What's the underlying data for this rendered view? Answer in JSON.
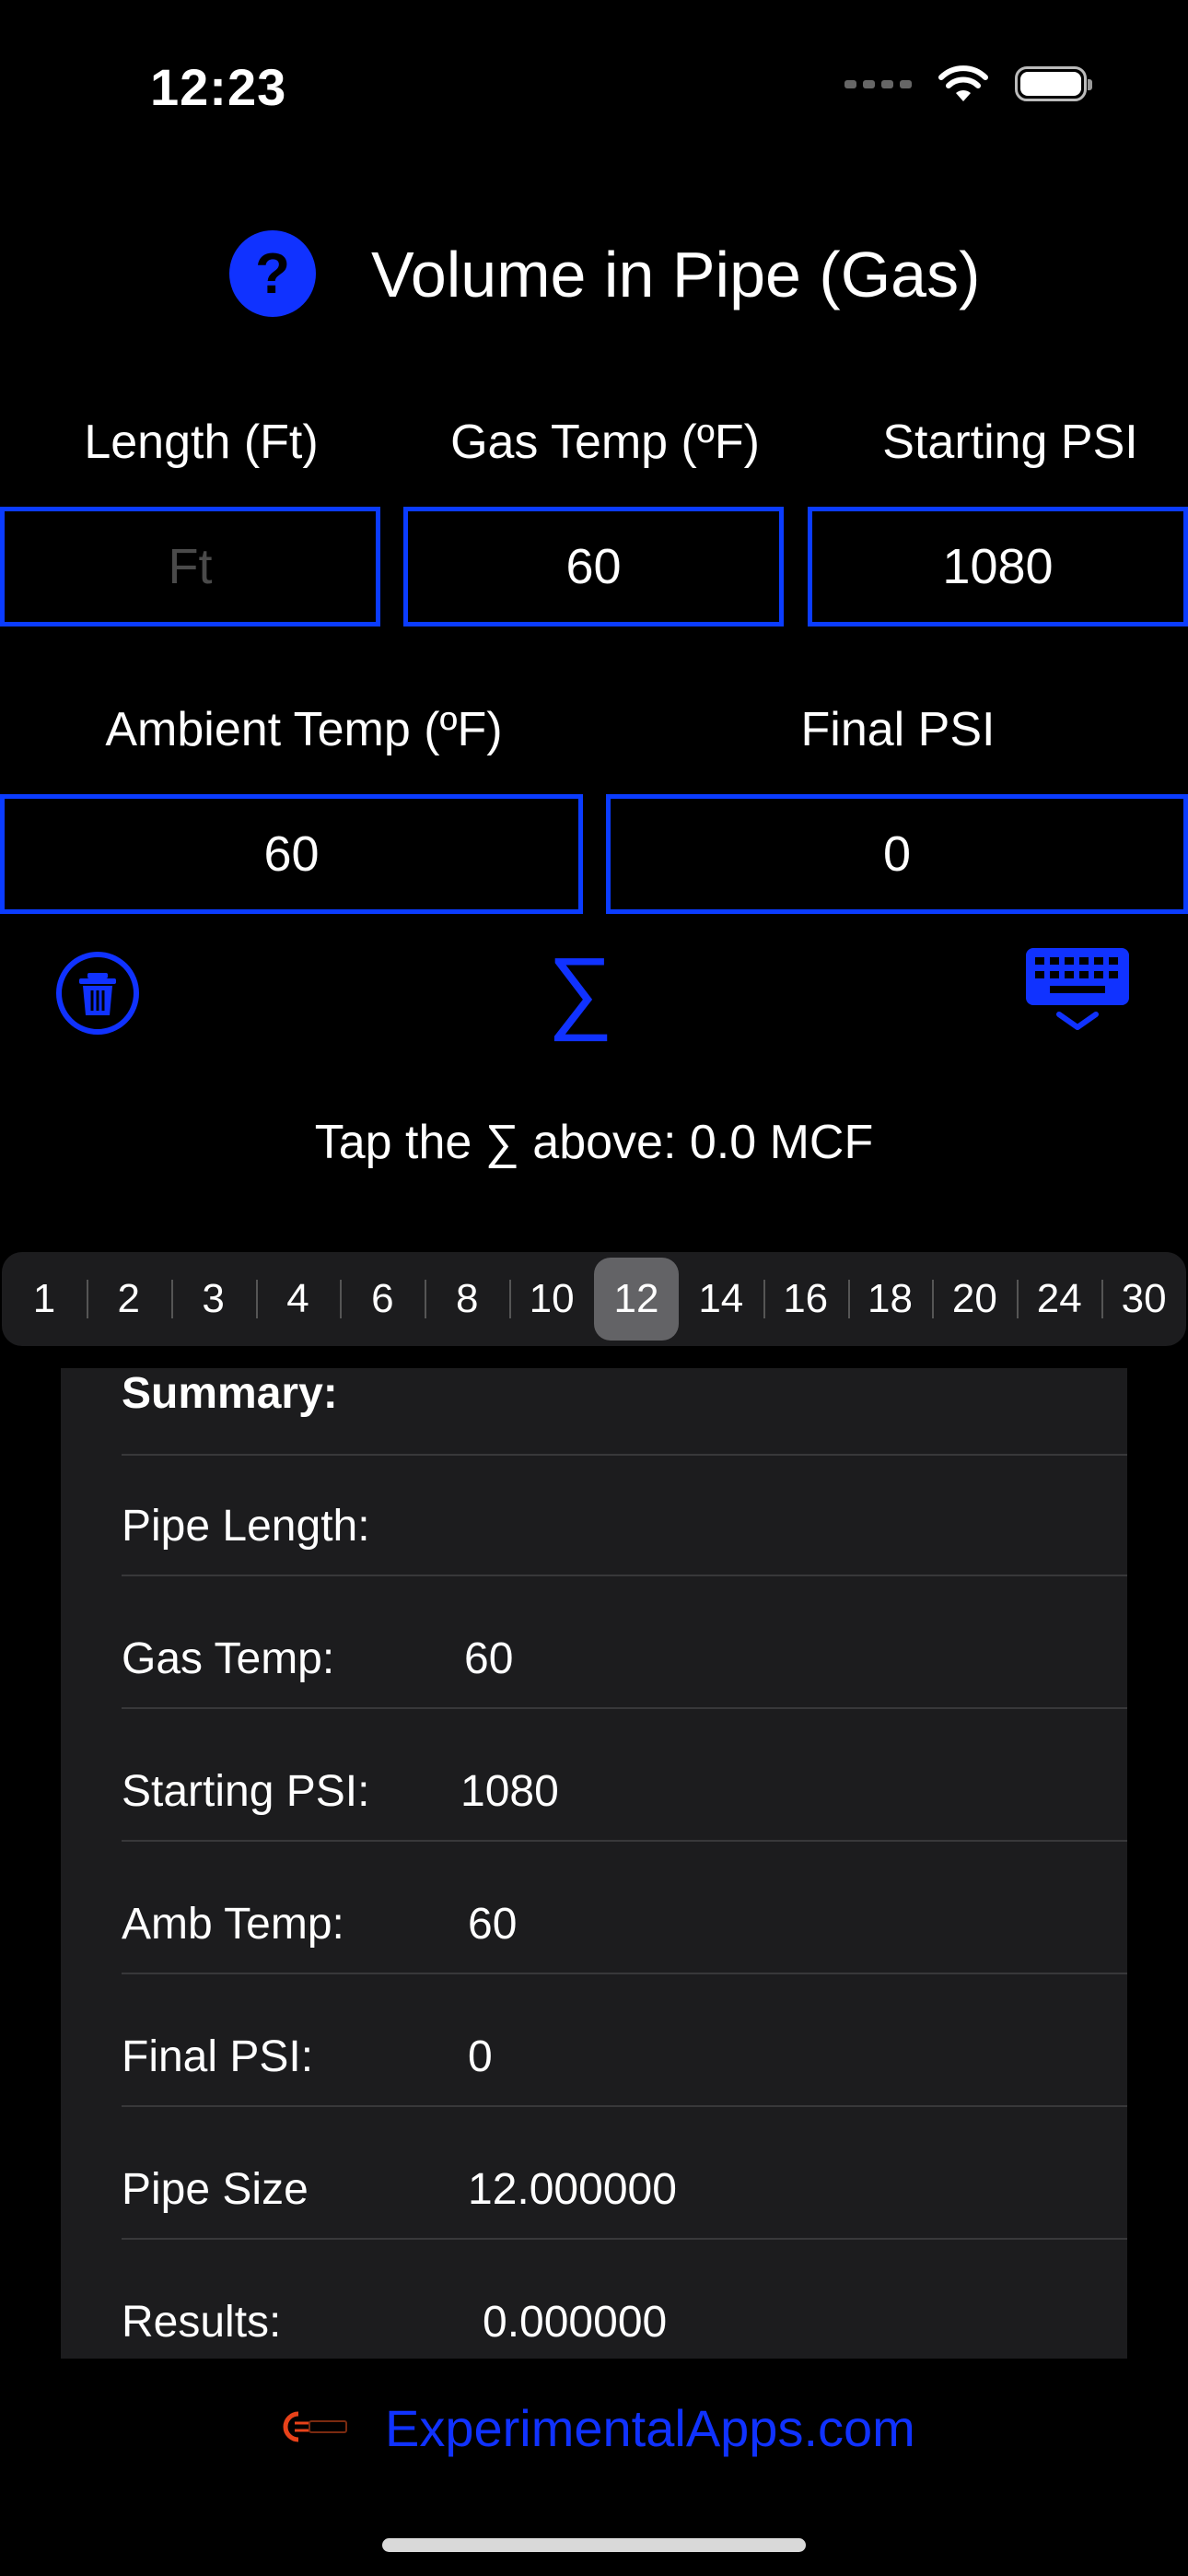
{
  "status": {
    "time": "12:23"
  },
  "header": {
    "help_icon": "question-icon",
    "help_label": "?",
    "title": "Volume in Pipe (Gas)"
  },
  "inputs": {
    "length": {
      "label": "Length (Ft)",
      "value": "",
      "placeholder": "Ft"
    },
    "gas_temp": {
      "label": "Gas Temp (ºF)",
      "value": "60",
      "placeholder": ""
    },
    "starting_psi": {
      "label": "Starting PSI",
      "value": "1080",
      "placeholder": ""
    },
    "ambient_temp": {
      "label": "Ambient Temp (ºF)",
      "value": "60",
      "placeholder": ""
    },
    "final_psi": {
      "label": "Final PSI",
      "value": "0",
      "placeholder": ""
    }
  },
  "toolbar": {
    "clear_icon": "trash-icon",
    "calc_icon": "sigma-icon",
    "calc_symbol": "∑",
    "keyboard_icon": "keyboard-dismiss-icon"
  },
  "hint": "Tap the ∑ above: 0.0 MCF",
  "pipe_sizes": {
    "options": [
      "1",
      "2",
      "3",
      "4",
      "6",
      "8",
      "10",
      "12",
      "14",
      "16",
      "18",
      "20",
      "24",
      "30"
    ],
    "selected": "12"
  },
  "summary": {
    "title": "Summary:",
    "rows": [
      {
        "key": "Pipe Length:",
        "value": ""
      },
      {
        "key": "Gas Temp:",
        "value": "60"
      },
      {
        "key": "Starting PSI:",
        "value": "1080"
      },
      {
        "key": "Amb Temp:",
        "value": "60"
      },
      {
        "key": "Final PSI:",
        "value": "0"
      },
      {
        "key": "Pipe Size",
        "value": "12.000000"
      },
      {
        "key": "Results:",
        "value": "0.000000"
      }
    ]
  },
  "footer": {
    "logo": "experimentalapps-logo",
    "link": "ExperimentalApps.com"
  },
  "colors": {
    "accent": "#1032ff",
    "background": "#000000",
    "panel": "#1c1c1e",
    "segment_selected": "#636366"
  }
}
